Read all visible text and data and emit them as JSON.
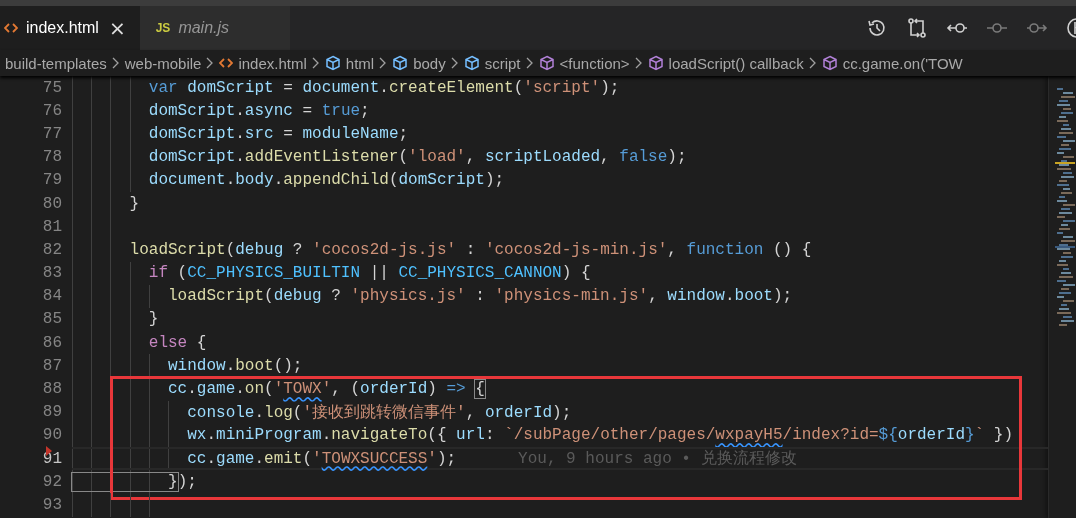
{
  "tabs": [
    {
      "label": "index.html",
      "kind": "html",
      "selected": true,
      "preview": false,
      "close": "×"
    },
    {
      "label": "main.js",
      "kind": "js",
      "icon_label": "JS",
      "selected": false,
      "preview": true
    }
  ],
  "toolbar": [
    {
      "kind": "history",
      "disabled": false
    },
    {
      "kind": "compare",
      "disabled": false
    },
    {
      "kind": "commit-prev",
      "disabled": false
    },
    {
      "kind": "commit",
      "disabled": true
    },
    {
      "kind": "commit-next",
      "disabled": true
    },
    {
      "kind": "branch",
      "disabled": false
    }
  ],
  "breadcrumbs": [
    {
      "text": "build-templates",
      "kind": "folder"
    },
    {
      "text": "web-mobile",
      "kind": "folder"
    },
    {
      "text": "index.html",
      "kind": "file"
    },
    {
      "text": "html",
      "kind": "element"
    },
    {
      "text": "body",
      "kind": "element"
    },
    {
      "text": "script",
      "kind": "element"
    },
    {
      "text": "<function>",
      "kind": "symbol"
    },
    {
      "text": "loadScript() callback",
      "kind": "symbol"
    },
    {
      "text": "cc.game.on('TOW",
      "kind": "symbol"
    }
  ],
  "lines": [
    {
      "number": "75",
      "current": false,
      "boxed": false,
      "tokens": [
        {
          "text": "        var ",
          "kind": "kw"
        },
        {
          "text": "domScript",
          "kind": "var"
        },
        {
          "text": " = ",
          "kind": "plain"
        },
        {
          "text": "document",
          "kind": "var"
        },
        {
          "text": ".",
          "kind": "plain"
        },
        {
          "text": "createElement",
          "kind": "fn"
        },
        {
          "text": "(",
          "kind": "plain"
        },
        {
          "text": "'script'",
          "kind": "str"
        },
        {
          "text": ");",
          "kind": "plain"
        }
      ]
    },
    {
      "number": "76",
      "current": false,
      "boxed": false,
      "tokens": [
        {
          "text": "        domScript",
          "kind": "var"
        },
        {
          "text": ".",
          "kind": "plain"
        },
        {
          "text": "async",
          "kind": "var"
        },
        {
          "text": " = ",
          "kind": "plain"
        },
        {
          "text": "true",
          "kind": "kw"
        },
        {
          "text": ";",
          "kind": "plain"
        }
      ]
    },
    {
      "number": "77",
      "current": false,
      "boxed": false,
      "tokens": [
        {
          "text": "        domScript",
          "kind": "var"
        },
        {
          "text": ".",
          "kind": "plain"
        },
        {
          "text": "src",
          "kind": "var"
        },
        {
          "text": " = ",
          "kind": "plain"
        },
        {
          "text": "moduleName",
          "kind": "var"
        },
        {
          "text": ";",
          "kind": "plain"
        }
      ]
    },
    {
      "number": "78",
      "current": false,
      "boxed": false,
      "tokens": [
        {
          "text": "        domScript",
          "kind": "var"
        },
        {
          "text": ".",
          "kind": "plain"
        },
        {
          "text": "addEventListener",
          "kind": "fn"
        },
        {
          "text": "(",
          "kind": "plain"
        },
        {
          "text": "'load'",
          "kind": "str"
        },
        {
          "text": ", ",
          "kind": "plain"
        },
        {
          "text": "scriptLoaded",
          "kind": "var"
        },
        {
          "text": ", ",
          "kind": "plain"
        },
        {
          "text": "false",
          "kind": "kw"
        },
        {
          "text": ");",
          "kind": "plain"
        }
      ]
    },
    {
      "number": "79",
      "current": false,
      "boxed": false,
      "tokens": [
        {
          "text": "        document",
          "kind": "var"
        },
        {
          "text": ".",
          "kind": "plain"
        },
        {
          "text": "body",
          "kind": "var"
        },
        {
          "text": ".",
          "kind": "plain"
        },
        {
          "text": "appendChild",
          "kind": "fn"
        },
        {
          "text": "(",
          "kind": "plain"
        },
        {
          "text": "domScript",
          "kind": "var"
        },
        {
          "text": ");",
          "kind": "plain"
        }
      ]
    },
    {
      "number": "80",
      "current": false,
      "boxed": false,
      "tokens": [
        {
          "text": "      }",
          "kind": "plain"
        }
      ]
    },
    {
      "number": "81",
      "current": false,
      "boxed": false
    },
    {
      "number": "82",
      "current": false,
      "boxed": false,
      "tokens": [
        {
          "text": "      loadScript",
          "kind": "fn"
        },
        {
          "text": "(",
          "kind": "plain"
        },
        {
          "text": "debug",
          "kind": "var"
        },
        {
          "text": " ? ",
          "kind": "plain"
        },
        {
          "text": "'cocos2d-js.js'",
          "kind": "str"
        },
        {
          "text": " : ",
          "kind": "plain"
        },
        {
          "text": "'cocos2d-js-min.js'",
          "kind": "str"
        },
        {
          "text": ", ",
          "kind": "plain"
        },
        {
          "text": "function",
          "kind": "kw"
        },
        {
          "text": " () {",
          "kind": "plain"
        }
      ]
    },
    {
      "number": "83",
      "current": false,
      "boxed": false,
      "tokens": [
        {
          "text": "        if",
          "kind": "ctl"
        },
        {
          "text": " (",
          "kind": "plain"
        },
        {
          "text": "CC_PHYSICS_BUILTIN",
          "kind": "const"
        },
        {
          "text": " || ",
          "kind": "plain"
        },
        {
          "text": "CC_PHYSICS_CANNON",
          "kind": "const"
        },
        {
          "text": ") {",
          "kind": "plain"
        }
      ]
    },
    {
      "number": "84",
      "current": false,
      "boxed": false,
      "tokens": [
        {
          "text": "          loadScript",
          "kind": "fn"
        },
        {
          "text": "(",
          "kind": "plain"
        },
        {
          "text": "debug",
          "kind": "var"
        },
        {
          "text": " ? ",
          "kind": "plain"
        },
        {
          "text": "'physics.js'",
          "kind": "str"
        },
        {
          "text": " : ",
          "kind": "plain"
        },
        {
          "text": "'physics-min.js'",
          "kind": "str"
        },
        {
          "text": ", ",
          "kind": "plain"
        },
        {
          "text": "window",
          "kind": "var"
        },
        {
          "text": ".",
          "kind": "plain"
        },
        {
          "text": "boot",
          "kind": "var"
        },
        {
          "text": ");",
          "kind": "plain"
        }
      ]
    },
    {
      "number": "85",
      "current": false,
      "boxed": false,
      "tokens": [
        {
          "text": "        }",
          "kind": "plain"
        }
      ]
    },
    {
      "number": "86",
      "current": false,
      "boxed": false,
      "tokens": [
        {
          "text": "        else",
          "kind": "ctl"
        },
        {
          "text": " {",
          "kind": "plain"
        }
      ]
    },
    {
      "number": "87",
      "current": false,
      "boxed": false,
      "tokens": [
        {
          "text": "          window",
          "kind": "var"
        },
        {
          "text": ".",
          "kind": "plain"
        },
        {
          "text": "boot",
          "kind": "fn"
        },
        {
          "text": "();",
          "kind": "plain"
        }
      ]
    },
    {
      "number": "88",
      "current": false,
      "boxed": true,
      "tokens": [
        {
          "text": "          cc",
          "kind": "var"
        },
        {
          "text": ".",
          "kind": "plain"
        },
        {
          "text": "game",
          "kind": "var"
        },
        {
          "text": ".",
          "kind": "plain"
        },
        {
          "text": "on",
          "kind": "fn"
        },
        {
          "text": "(",
          "kind": "plain"
        },
        {
          "text": "'",
          "kind": "str"
        },
        {
          "text": "TOWX",
          "kind": "str",
          "squiggle": true
        },
        {
          "text": "'",
          "kind": "str"
        },
        {
          "text": ", (",
          "kind": "plain"
        },
        {
          "text": "orderId",
          "kind": "var"
        },
        {
          "text": ") ",
          "kind": "plain"
        },
        {
          "text": "=> ",
          "kind": "kw"
        },
        {
          "text": "{",
          "kind": "plain",
          "bracket_match": true
        }
      ]
    },
    {
      "number": "89",
      "current": false,
      "boxed": true,
      "tokens": [
        {
          "text": "            console",
          "kind": "var"
        },
        {
          "text": ".",
          "kind": "plain"
        },
        {
          "text": "log",
          "kind": "fn"
        },
        {
          "text": "(",
          "kind": "plain"
        },
        {
          "text": "'接收到跳转微信事件'",
          "kind": "str"
        },
        {
          "text": ", ",
          "kind": "plain"
        },
        {
          "text": "orderId",
          "kind": "var"
        },
        {
          "text": ");",
          "kind": "plain"
        }
      ]
    },
    {
      "number": "90",
      "current": false,
      "boxed": true,
      "tokens": [
        {
          "text": "            wx",
          "kind": "var"
        },
        {
          "text": ".",
          "kind": "plain"
        },
        {
          "text": "miniProgram",
          "kind": "var"
        },
        {
          "text": ".",
          "kind": "plain"
        },
        {
          "text": "navigateTo",
          "kind": "fn"
        },
        {
          "text": "({ ",
          "kind": "plain"
        },
        {
          "text": "url",
          "kind": "var"
        },
        {
          "text": ": ",
          "kind": "plain"
        },
        {
          "text": "`/subPage/other/pages/",
          "kind": "str"
        },
        {
          "text": "wxpayH5",
          "kind": "str",
          "squiggle": true
        },
        {
          "text": "/index?id=",
          "kind": "str"
        },
        {
          "text": "${",
          "kind": "kw"
        },
        {
          "text": "orderId",
          "kind": "var"
        },
        {
          "text": "}",
          "kind": "kw"
        },
        {
          "text": "`",
          "kind": "str"
        },
        {
          "text": " })",
          "kind": "plain"
        }
      ]
    },
    {
      "number": "91",
      "current": true,
      "boxed": true,
      "deleted_marker": true,
      "blame": "You, 9 hours ago • 兑换流程修改",
      "tokens": [
        {
          "text": "            cc",
          "kind": "var"
        },
        {
          "text": ".",
          "kind": "plain"
        },
        {
          "text": "game",
          "kind": "var"
        },
        {
          "text": ".",
          "kind": "plain"
        },
        {
          "text": "emit",
          "kind": "fn"
        },
        {
          "text": "(",
          "kind": "plain"
        },
        {
          "text": "'",
          "kind": "str"
        },
        {
          "text": "TOWXSUCCESS",
          "kind": "str",
          "squiggle": true
        },
        {
          "text": "'",
          "kind": "str"
        },
        {
          "text": ");",
          "kind": "plain"
        }
      ]
    },
    {
      "number": "92",
      "current": false,
      "boxed": true,
      "tokens": [
        {
          "text": "          }",
          "kind": "plain",
          "bracket_match": true
        },
        {
          "text": ");",
          "kind": "plain"
        }
      ]
    },
    {
      "number": "93",
      "current": false,
      "boxed": false
    }
  ]
}
